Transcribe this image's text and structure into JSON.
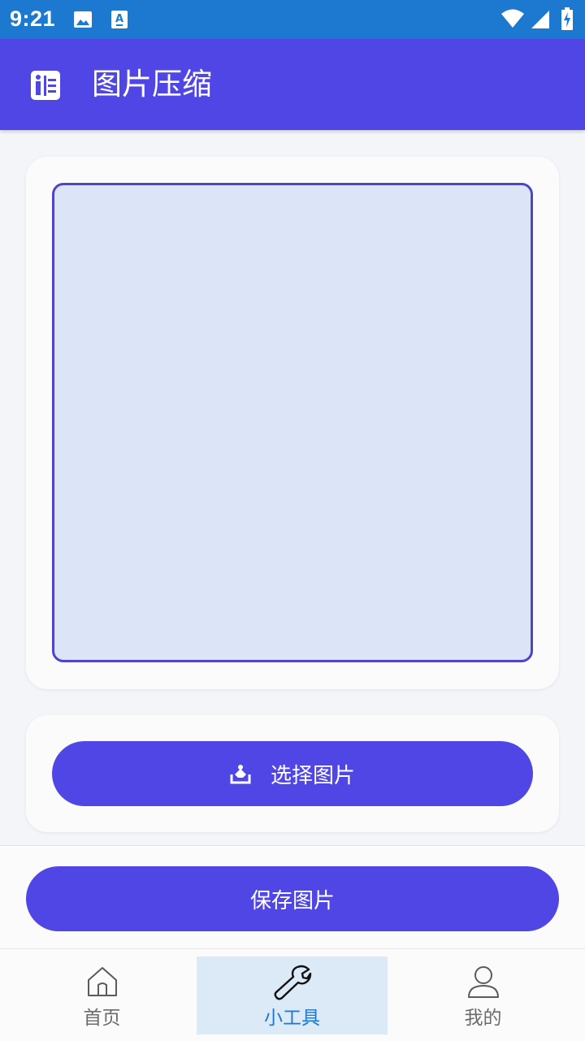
{
  "status_bar": {
    "time": "9:21",
    "icons": [
      "image-notification-icon",
      "font-notification-icon",
      "wifi-icon",
      "signal-icon",
      "battery-charging-icon"
    ],
    "background": "#1d78cf"
  },
  "app_bar": {
    "title": "图片压缩",
    "icon": "compress-app-icon",
    "background": "#4f46e5"
  },
  "image_preview": {
    "background": "#dce4f7",
    "border_color": "#4e45c9"
  },
  "select_button": {
    "label": "选择图片",
    "icon": "image-select-icon"
  },
  "save_button": {
    "label": "保存图片"
  },
  "bottom_nav": {
    "items": [
      {
        "label": "首页",
        "icon": "home-icon",
        "active": false
      },
      {
        "label": "小工具",
        "icon": "wrench-icon",
        "active": true
      },
      {
        "label": "我的",
        "icon": "user-icon",
        "active": false
      }
    ],
    "active_color": "#1d78cf",
    "active_background": "#dce9f7"
  },
  "colors": {
    "accent": "#4f46e5",
    "page_background": "#f3f5f8"
  }
}
